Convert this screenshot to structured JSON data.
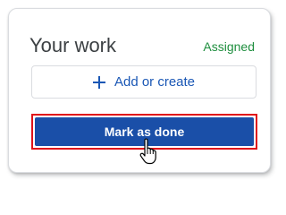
{
  "card": {
    "title": "Your work",
    "status": "Assigned",
    "add_button_label": "Add or create",
    "done_button_label": "Mark as done"
  },
  "icons": {
    "add": "plus-icon",
    "cursor": "hand-pointer-cursor-icon"
  },
  "colors": {
    "status": "#1e8e3e",
    "add_button_text": "#1a57b5",
    "done_button_bg": "#1a4fa8",
    "highlight_border": "#e0131a"
  }
}
